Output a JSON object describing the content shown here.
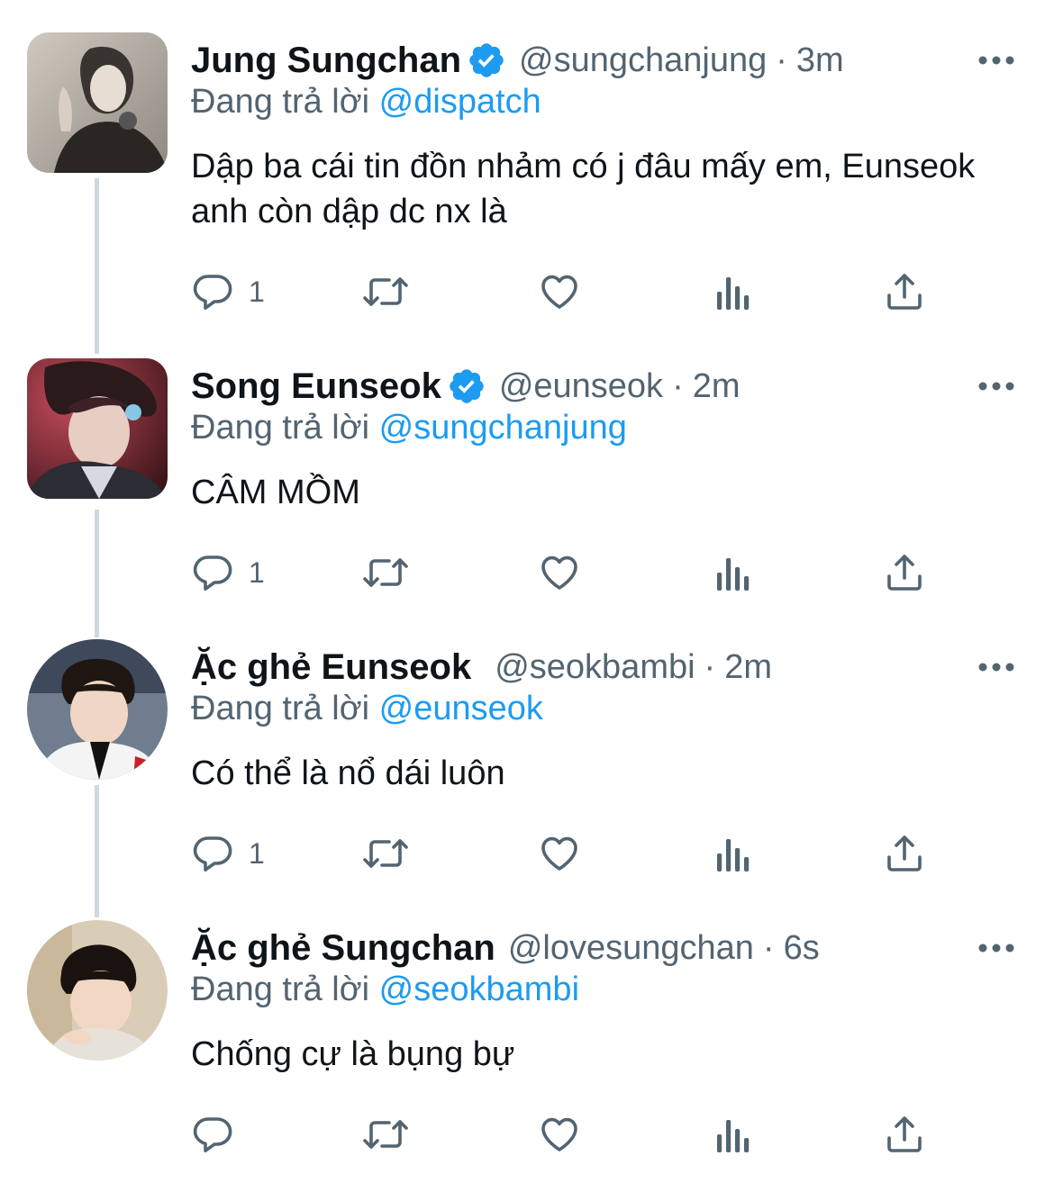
{
  "tweets": [
    {
      "name": "Jung Sungchan",
      "verified": true,
      "handle": "@sungchanjung",
      "separator": "·",
      "time": "3m",
      "replying_prefix": "Đang trả lời",
      "replying_to": "@dispatch",
      "text": "Dập ba cái tin đồn nhảm có j đâu mấy em, Eunseok anh còn dập dc nx là",
      "reply_count": "1",
      "avatar": "square"
    },
    {
      "name": "Song Eunseok",
      "verified": true,
      "handle": "@eunseok",
      "separator": "·",
      "time": "2m",
      "replying_prefix": "Đang trả lời",
      "replying_to": "@sungchanjung",
      "text": "CÂM MỒM",
      "reply_count": "1",
      "avatar": "square"
    },
    {
      "name": "Ặc ghẻ Eunseok",
      "verified": false,
      "handle": "@seokbambi",
      "separator": "·",
      "time": "2m",
      "replying_prefix": "Đang trả lời",
      "replying_to": "@eunseok",
      "text": "Có thể là nổ dái luôn",
      "reply_count": "1",
      "avatar": "round"
    },
    {
      "name": "Ặc ghẻ Sungchan",
      "verified": false,
      "handle": "@lovesungchan",
      "separator": "·",
      "time": "6s",
      "replying_prefix": "Đang trả lời",
      "replying_to": "@seokbambi",
      "text": "Chống cự là bụng bự",
      "reply_count": "",
      "avatar": "round"
    }
  ],
  "icons": {
    "more": "more-horizontal-icon",
    "reply": "reply-bubble-icon",
    "retweet": "retweet-icon",
    "like": "heart-icon",
    "views": "bar-chart-icon",
    "share": "share-upload-icon",
    "verified": "verified-badge-icon"
  },
  "colors": {
    "text_primary": "#0f1419",
    "text_secondary": "#536471",
    "accent": "#1d9bf0",
    "thread_line": "#cfd9de"
  }
}
